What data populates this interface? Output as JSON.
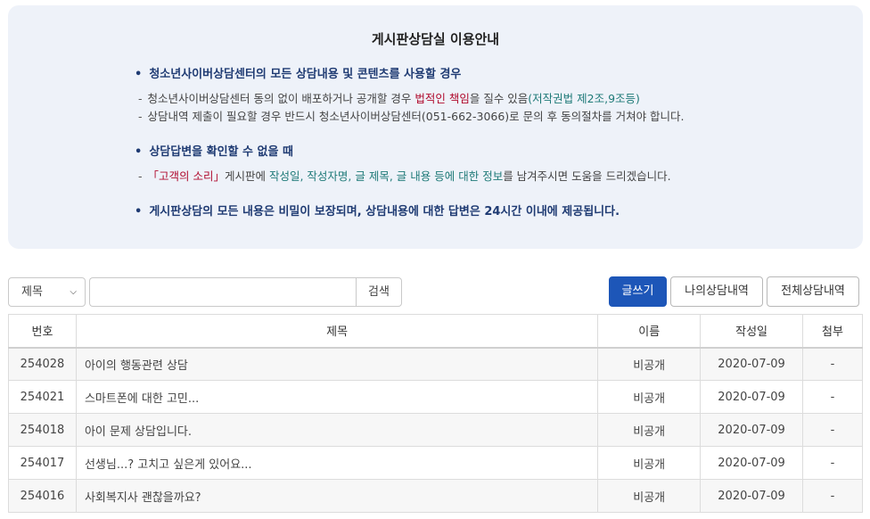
{
  "notice": {
    "title": "게시판상담실 이용안내",
    "b1": "청소년사이버상담센터의 모든 상담내용 및 콘텐츠를 사용할 경우",
    "b1_l1_a": "청소년사이버상담센터 동의 없이 배포하거나 공개할 경우 ",
    "b1_l1_red": "법적인 책임",
    "b1_l1_b": "을 질수 있음",
    "b1_l1_teal": "(저작권법 제2조,9조등)",
    "b1_l2": "상담내역 제출이 필요할 경우 반드시 청소년사이버상담센터(051-662-3066)로 문의 후 동의절차를 거쳐야 합니다.",
    "b2": "상담답변을 확인할 수 없을 때",
    "b2_l1_red": "「고객의 소리」",
    "b2_l1_a": "게시판에 ",
    "b2_l1_teal": "작성일, 작성자명, 글 제목, 글 내용 등에 대한 정보",
    "b2_l1_b": "를 남겨주시면 도움을 드리겠습니다.",
    "b3": "게시판상담의 모든 내용은 비밀이 보장되며, 상담내용에 대한 답변은 24시간 이내에 제공됩니다.",
    "dash": "-",
    "dot": "•"
  },
  "search": {
    "field_selected": "제목",
    "query": "",
    "button": "검색"
  },
  "actions": {
    "write": "글쓰기",
    "my_history": "나의상담내역",
    "all_history": "전체상담내역"
  },
  "table": {
    "headers": [
      "번호",
      "제목",
      "이름",
      "작성일",
      "첨부"
    ],
    "rows": [
      {
        "no": "254028",
        "subject": "아이의 행동관련 상담",
        "name": "비공개",
        "date": "2020-07-09",
        "attach": "-"
      },
      {
        "no": "254021",
        "subject": "스마트폰에 대한 고민...",
        "name": "비공개",
        "date": "2020-07-09",
        "attach": "-"
      },
      {
        "no": "254018",
        "subject": "아이 문제 상담입니다.",
        "name": "비공개",
        "date": "2020-07-09",
        "attach": "-"
      },
      {
        "no": "254017",
        "subject": "선생님...? 고치고 싶은게 있어요...",
        "name": "비공개",
        "date": "2020-07-09",
        "attach": "-"
      },
      {
        "no": "254016",
        "subject": "사회복지사 괜찮을까요?",
        "name": "비공개",
        "date": "2020-07-09",
        "attach": "-"
      }
    ]
  },
  "colors": {
    "primary": "#1d56b8",
    "notice_bg": "#eef2f9",
    "emphasis_red": "#b00b2e",
    "emphasis_teal": "#1f7a78",
    "bullet_navy": "#1f3b73"
  }
}
